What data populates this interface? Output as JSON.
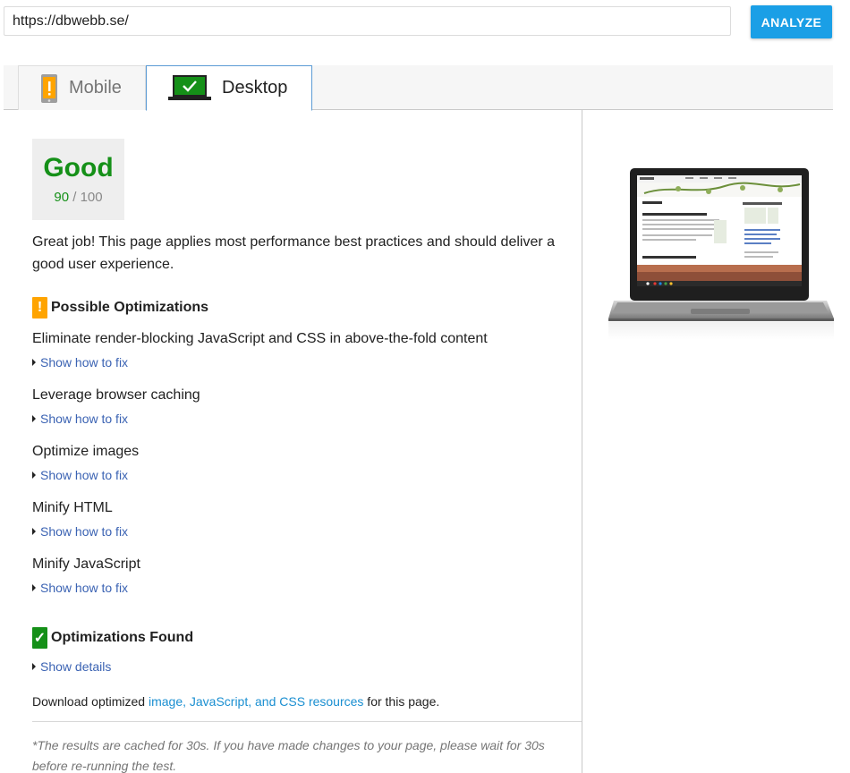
{
  "url_bar": {
    "value": "https://dbwebb.se/",
    "analyze_label": "ANALYZE"
  },
  "tabs": [
    {
      "label": "Mobile",
      "icon": "phone-warning-icon",
      "active": false
    },
    {
      "label": "Desktop",
      "icon": "laptop-check-icon",
      "active": true
    }
  ],
  "score": {
    "label": "Good",
    "value": "90",
    "max": "/ 100",
    "color": "#159018"
  },
  "summary": "Great job! This page applies most performance best practices and should deliver a good user experience.",
  "possible_optimizations": {
    "heading": "Possible Optimizations",
    "badge": "!",
    "items": [
      {
        "title": "Eliminate render-blocking JavaScript and CSS in above-the-fold content",
        "link": "Show how to fix"
      },
      {
        "title": "Leverage browser caching",
        "link": "Show how to fix"
      },
      {
        "title": "Optimize images",
        "link": "Show how to fix"
      },
      {
        "title": "Minify HTML",
        "link": "Show how to fix"
      },
      {
        "title": "Minify JavaScript",
        "link": "Show how to fix"
      }
    ]
  },
  "optimizations_found": {
    "heading": "Optimizations Found",
    "badge": "✓",
    "link": "Show details"
  },
  "download": {
    "prefix": "Download optimized ",
    "link": "image, JavaScript, and CSS resources",
    "suffix": " for this page."
  },
  "cache_note": "*The results are cached for 30s. If you have made changes to your page, please wait for 30s before re-running the test.",
  "colors": {
    "accent": "#1a9fe6",
    "good": "#159018",
    "warning": "#ffa400",
    "link": "#3b63b3"
  }
}
